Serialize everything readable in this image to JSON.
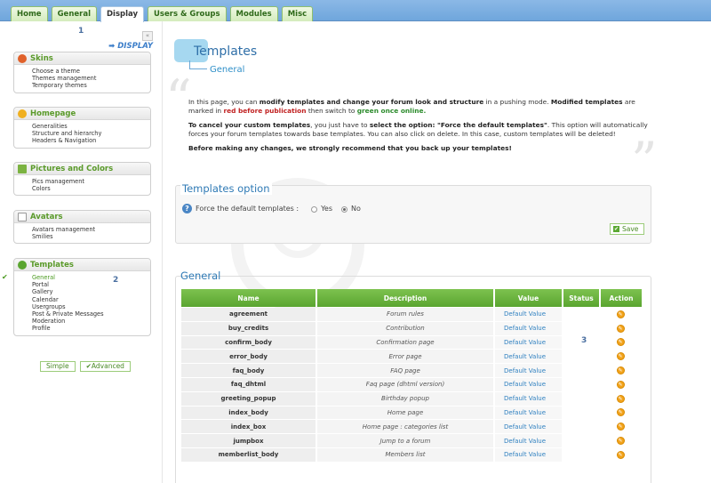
{
  "tabs": [
    {
      "label": "Home"
    },
    {
      "label": "General"
    },
    {
      "label": "Display"
    },
    {
      "label": "Users & Groups"
    },
    {
      "label": "Modules"
    },
    {
      "label": "Misc"
    }
  ],
  "sidebar": {
    "marker1": "1",
    "marker2": "2",
    "collapse_glyph": "«",
    "display_link": "➡ DISPLAY",
    "blocks": [
      {
        "title": "Skins",
        "items": [
          "Choose a theme",
          "Themes management",
          "Temporary themes"
        ]
      },
      {
        "title": "Homepage",
        "items": [
          "Generalities",
          "Structure and hierarchy",
          "Headers & Navigation"
        ]
      },
      {
        "title": "Pictures and Colors",
        "items": [
          "Pics management",
          "Colors"
        ]
      },
      {
        "title": "Avatars",
        "items": [
          "Avatars management",
          "Smilies"
        ]
      },
      {
        "title": "Templates",
        "items": [
          "General",
          "Portal",
          "Gallery",
          "Calendar",
          "Usergroups",
          "Post & Private Messages",
          "Moderation",
          "Profile"
        ]
      }
    ],
    "mode_simple": "Simple",
    "mode_advanced": "✔Advanced"
  },
  "main": {
    "title": "Templates",
    "subtitle": "General",
    "intro1_a": "In this page, you can ",
    "intro1_b": "modify templates and change your forum look and structure",
    "intro1_c": " in a pushing mode. ",
    "intro1_d": "Modified templates",
    "intro1_e": " are marked in ",
    "intro1_f": "red before publication",
    "intro1_g": " then switch to ",
    "intro1_h": "green once online.",
    "intro2_a": "To cancel your custom templates",
    "intro2_b": ", you just have to ",
    "intro2_c": "select the option: \"Force the default templates\"",
    "intro2_d": ". This option will automatically forces your forum templates towards base templates. You can also click on delete. In this case, custom templates will be deleted!",
    "intro3_a": "Before making any changes, we strongly recommend that you ",
    "intro3_b": "back up your templates!",
    "option_legend": "Templates option",
    "option_label": "Force the default templates :",
    "yes": "Yes",
    "no": "No",
    "save": "Save",
    "general_legend": "General",
    "marker3": "3"
  },
  "table": {
    "headers": [
      "Name",
      "Description",
      "Value",
      "Status",
      "Action"
    ],
    "rows": [
      {
        "name": "agreement",
        "desc": "Forum rules",
        "value": "Default Value"
      },
      {
        "name": "buy_credits",
        "desc": "Contribution",
        "value": "Default Value"
      },
      {
        "name": "confirm_body",
        "desc": "Confirmation page",
        "value": "Default Value"
      },
      {
        "name": "error_body",
        "desc": "Error page",
        "value": "Default Value"
      },
      {
        "name": "faq_body",
        "desc": "FAQ page",
        "value": "Default Value"
      },
      {
        "name": "faq_dhtml",
        "desc": "Faq page (dhtml version)",
        "value": "Default Value"
      },
      {
        "name": "greeting_popup",
        "desc": "Birthday popup",
        "value": "Default Value"
      },
      {
        "name": "index_body",
        "desc": "Home page",
        "value": "Default Value"
      },
      {
        "name": "index_box",
        "desc": "Home page : categories list",
        "value": "Default Value"
      },
      {
        "name": "jumpbox",
        "desc": "Jump to a forum",
        "value": "Default Value"
      },
      {
        "name": "memberlist_body",
        "desc": "Members list",
        "value": "Default Value"
      }
    ]
  },
  "colors": {
    "accent_green": "#5aa530",
    "title_blue": "#2f6fa8",
    "modified_red": "#c02020"
  }
}
